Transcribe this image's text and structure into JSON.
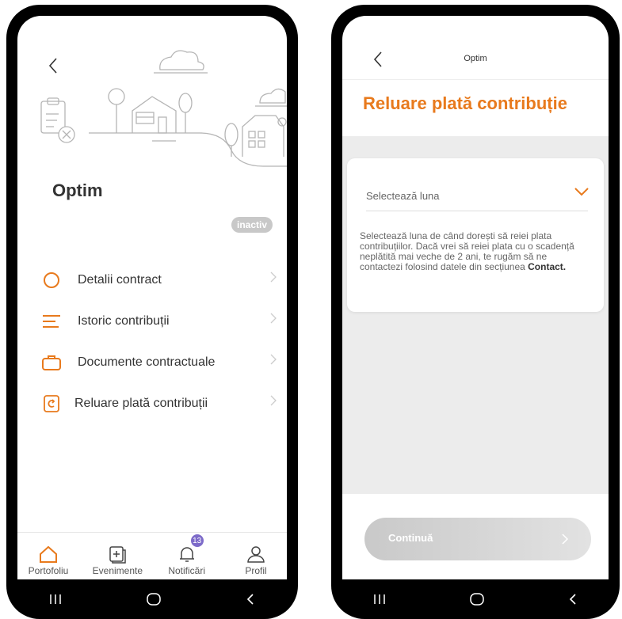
{
  "left": {
    "title": "Optim",
    "status": "inactiv",
    "menu": [
      {
        "label": "Detalii contract",
        "icon": "circle-icon"
      },
      {
        "label": "Istoric contribuții",
        "icon": "list-icon"
      },
      {
        "label": "Documente contractuale",
        "icon": "briefcase-icon"
      },
      {
        "label": "Reluare plată contribuții",
        "icon": "document-refresh-icon"
      }
    ],
    "tabs": [
      {
        "label": "Portofoliu",
        "icon": "home-icon"
      },
      {
        "label": "Evenimente",
        "icon": "add-document-icon"
      },
      {
        "label": "Notificări",
        "icon": "bell-icon",
        "badge": "13"
      },
      {
        "label": "Profil",
        "icon": "user-icon"
      }
    ]
  },
  "right": {
    "header_title": "Optim",
    "page_title": "Reluare plată contribuție",
    "select_placeholder": "Selectează luna",
    "helper_text": "Selectează luna de când dorești să reiei plata contribuțiilor. Dacă vrei să reiei plata cu o scadență neplătită mai veche de 2 ani, te rugăm să ne contactezi folosind datele din secțiunea ",
    "helper_bold": "Contact.",
    "continue_label": "Continuă"
  },
  "colors": {
    "accent": "#e87a1d",
    "badge": "#7d6bc9",
    "inactive": "#c8c8c8"
  }
}
